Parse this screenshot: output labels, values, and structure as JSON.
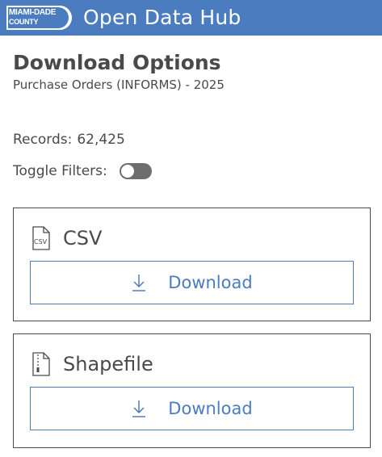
{
  "header": {
    "logo_top": "MIAMI-DADE",
    "logo_bottom": "COUNTY",
    "title": "Open Data Hub",
    "brand_color": "#4c7cc0"
  },
  "page": {
    "title": "Download Options",
    "subtitle": "Purchase Orders (INFORMS) - 2025"
  },
  "stats": {
    "records_label": "Records:",
    "records_value": "62,425"
  },
  "filters": {
    "label": "Toggle Filters:",
    "enabled": false
  },
  "downloads": [
    {
      "format": "CSV",
      "icon": "csv-file-icon",
      "icon_text": "CSV",
      "button_label": "Download",
      "button_icon": "download-icon"
    },
    {
      "format": "Shapefile",
      "icon": "zip-file-icon",
      "button_label": "Download",
      "button_icon": "download-icon"
    }
  ]
}
